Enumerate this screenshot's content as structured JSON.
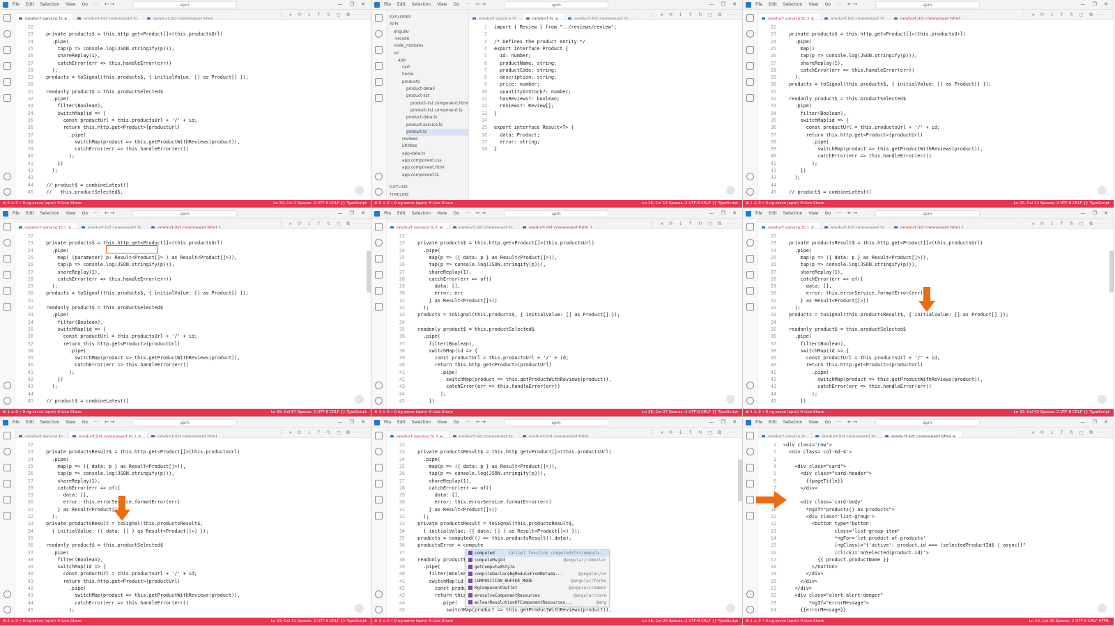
{
  "app": {
    "menu": [
      "File",
      "Edit",
      "Selection",
      "View",
      "Go",
      "···"
    ],
    "search": "apm",
    "window_controls": "— ❐ ✕"
  },
  "panes": [
    {
      "tabs": [
        {
          "label": "product.service.ts",
          "active": true
        },
        {
          "label": "product-list.component.ts",
          "active": false
        },
        {
          "label": "product-list.component.html",
          "active": false
        }
      ],
      "first_line": 22,
      "lines": [
        "",
        "  private products$ = this.http.get<Product[]>(this.productsUrl)",
        "    .pipe(",
        "      tap(p => console.log(JSON.stringify(p))),",
        "      shareReplay(1),",
        "      catchError(err => this.handleError(err))",
        "    );",
        "  products = toSignal(this.products$, { initialValue: [] as Product[] });",
        "",
        "  readonly product$ = this.productSelected$",
        "    .pipe(",
        "      filter(Boolean),",
        "      switchMap(id => {",
        "        const productUrl = this.productsUrl + '/' + id;",
        "        return this.http.get<Product>(productUrl)",
        "          .pipe(",
        "            switchMap(product => this.getProductWithReviews(product)),",
        "            catchError(err => this.handleError(err))",
        "          );",
        "      })",
        "    );",
        "",
        "  // product$ = combineLatest([",
        "  //   this.productSelected$,"
      ],
      "status_left": "⊗ 0 ⚠ 0   ⑂ 0   ng serve (apm)   ⟲ Live Share",
      "status_right": "Ln 30, Col 1   Spaces: 2   UTF-8   CRLF   {} TypeScript"
    },
    {
      "tabs": [
        {
          "label": "product.service.ts",
          "active": false
        },
        {
          "label": "product.ts",
          "active": true
        },
        {
          "label": "product-list.component.ts",
          "active": false
        }
      ],
      "explorer": [
        {
          "label": "EXPLORER",
          "depth": 0,
          "head": true
        },
        {
          "label": "APM",
          "depth": 0,
          "head": true
        },
        {
          "label": "angular",
          "depth": 1
        },
        {
          "label": ".vscode",
          "depth": 1
        },
        {
          "label": "node_modules",
          "depth": 1
        },
        {
          "label": "src",
          "depth": 1
        },
        {
          "label": "app",
          "depth": 2
        },
        {
          "label": "cart",
          "depth": 3
        },
        {
          "label": "home",
          "depth": 3
        },
        {
          "label": "products",
          "depth": 3
        },
        {
          "label": "product-detail",
          "depth": 4
        },
        {
          "label": "product-list",
          "depth": 4
        },
        {
          "label": "product-list.component.html",
          "depth": 5
        },
        {
          "label": "product-list.component.ts",
          "depth": 5
        },
        {
          "label": "product-data.ts",
          "depth": 4
        },
        {
          "label": "product.service.ts",
          "depth": 4
        },
        {
          "label": "product.ts",
          "depth": 4,
          "selected": true
        },
        {
          "label": "reviews",
          "depth": 3
        },
        {
          "label": "utilities",
          "depth": 3
        },
        {
          "label": "app-data.ts",
          "depth": 3
        },
        {
          "label": "app.component.css",
          "depth": 3
        },
        {
          "label": "app.component.html",
          "depth": 3
        },
        {
          "label": "app.component.ts",
          "depth": 3
        },
        {
          "label": "OUTLINE",
          "depth": 0,
          "head": true
        },
        {
          "label": "TIMELINE",
          "depth": 0,
          "head": true
        }
      ],
      "first_line": 1,
      "lines": [
        "import { Review } from \"../reviews/review\";",
        "",
        "/* Defines the product entity */",
        "export interface Product {",
        "  id: number;",
        "  productName: string;",
        "  productCode: string;",
        "  description: string;",
        "  price: number;",
        "  quantityInStock?: number;",
        "  hasReviews?: boolean;",
        "  reviews?: Review[];",
        "}",
        "",
        "export interface Result<T> {",
        "  data: Product;",
        "  error: string;",
        "}"
      ],
      "status_left": "⊗ 0 ⚠ 0   ⑂ 0   ng serve (apm)   ⟲ Live Share",
      "status_right": "Ln 16, Col 13   Spaces: 2   UTF-8   CRLF   {} TypeScript"
    },
    {
      "tabs": [
        {
          "label": "product.service.ts 2",
          "active": true,
          "modified": true
        },
        {
          "label": "product-list.component.ts",
          "active": false
        },
        {
          "label": "product-list.component.html",
          "active": false,
          "modified": true
        }
      ],
      "first_line": 22,
      "lines": [
        "",
        "  private products$ = this.http.get<Product[]>(this.productsUrl)",
        "    .pipe(",
        "      map()",
        "      tap(p => console.log(JSON.stringify(p))),",
        "      shareReplay(1),",
        "      catchError(err => this.handleError(err))",
        "    );",
        "  products = toSignal(this.products$, { initialValue: [] as Product[] });",
        "",
        "  readonly product$ = this.productSelected$",
        "    .pipe(",
        "      filter(Boolean),",
        "      switchMap(id => {",
        "        const productUrl = this.productsUrl + '/' + id;",
        "        return this.http.get<Product>(productUrl)",
        "          .pipe(",
        "            switchMap(product => this.getProductWithReviews(product)),",
        "            catchError(err => this.handleError(err))",
        "          );",
        "      })",
        "    );",
        "",
        "  // product$ = combineLatest(["
      ],
      "status_left": "⊗ 1 ⚠ 0   ⑂ 0   ng serve (apm)   ⟲ Live Share",
      "status_right": "Ln 25, Col 12   Spaces: 2   UTF-8   CRLF   {} TypeScript"
    },
    {
      "tabs": [
        {
          "label": "product.service.ts 1",
          "active": true,
          "modified": true
        },
        {
          "label": "product-list.component.ts",
          "active": false
        },
        {
          "label": "product-list.component.html 1",
          "active": false,
          "modified": true
        }
      ],
      "first_line": 22,
      "lines": [
        "",
        "  private products$ = this.http.get<Product[]>(this.productsUrl)",
        "    .pipe(",
        "      map( (parameter) p: Result<Product[]> ) as Result<Product[]>)),",
        "      tap(p => console.log(JSON.stringify(p))),",
        "      shareReplay(1),",
        "      catchError(err => this.handleError(err))",
        "    );",
        "  products = toSignal(this.products$, { initialValue: [] as Product[] });",
        "",
        "  readonly product$ = this.productSelected$",
        "    .pipe(",
        "      filter(Boolean),",
        "      switchMap(id => {",
        "        const productUrl = this.productsUrl + '/' + id;",
        "        return this.http.get<Product>(productUrl)",
        "          .pipe(",
        "            switchMap(product => this.getProductWithReviews(product)),",
        "            catchError(err => this.handleError(err))",
        "          );",
        "      })",
        "    );",
        "",
        "  // product$ = combineLatest(["
      ],
      "status_left": "⊗ 1 ⚠ 0   ⑂ 0   ng serve (apm)   ⟲ Live Share",
      "status_right": "Ln 25, Col 67   Spaces: 2   UTF-8   CRLF   {} TypeScript"
    },
    {
      "tabs": [
        {
          "label": "product.service.ts 1",
          "active": true,
          "modified": true
        },
        {
          "label": "product-list.component.ts",
          "active": false
        },
        {
          "label": "product-list.component.html 1",
          "active": false,
          "modified": true
        }
      ],
      "first_line": 22,
      "lines": [
        "",
        "  private products$ = this.http.get<Product[]>(this.productsUrl)",
        "    .pipe(",
        "      map(p => ({ data: p } as Result<Product[]>)),",
        "      tap(p => console.log(JSON.stringify(p))),",
        "      shareReplay(1),",
        "      catchError(err => of({",
        "        data: [],",
        "        error: err",
        "      } as Result<Product[]>))",
        "    );",
        "  products = toSignal(this.products$, { initialValue: [] as Product[] });",
        "",
        "  readonly product$ = this.productSelected$",
        "    .pipe(",
        "      filter(Boolean),",
        "      switchMap(id => {",
        "        const productUrl = this.productsUrl + '/' + id;",
        "        return this.http.get<Product>(productUrl)",
        "          .pipe(",
        "            switchMap(product => this.getProductWithReviews(product)),",
        "            catchError(err => this.handleError(err))",
        "          );",
        "      })"
      ],
      "status_left": "⊗ 1 ⚠ 0   ⑂ 0   ng serve (apm)   ⟲ Live Share",
      "status_right": "Ln 28, Col 27   Spaces: 2   UTF-8   CRLF   {} TypeScript"
    },
    {
      "tabs": [
        {
          "label": "product.service.ts 1",
          "active": true,
          "modified": true
        },
        {
          "label": "product-list.component.ts",
          "active": false
        },
        {
          "label": "product-list.component.html 1",
          "active": false,
          "modified": true
        }
      ],
      "first_line": 22,
      "lines": [
        "",
        "  private productsResult$ = this.http.get<Product[]>(this.productsUrl)",
        "    .pipe(",
        "      map(p => ({ data: p } as Result<Product[]>)),",
        "      tap(p => console.log(JSON.stringify(p))),",
        "      shareReplay(1),",
        "      catchError(err => of({",
        "        data: [],",
        "        error: this.errorService.formatError(err)",
        "      } as Result<Product[]>))",
        "    );",
        "  products = toSignal(this.productsResult$, { initialValue: [] as Product[] });",
        "",
        "  readonly product$ = this.productSelected$",
        "    .pipe(",
        "      filter(Boolean),",
        "      switchMap(id => {",
        "        const productUrl = this.productsUrl + '/' + id;",
        "        return this.http.get<Product>(productUrl)",
        "          .pipe(",
        "            switchMap(product => this.getProductWithReviews(product)),",
        "            catchError(err => this.handleError(err))",
        "          );",
        "      })"
      ],
      "status_left": "⊗ 1 ⚠ 0   ⑂ 0   ng serve (apm)   ⟲ Live Share",
      "status_right": "Ln 33, Col 42   Spaces: 2   UTF-8   CRLF   {} TypeScript"
    },
    {
      "tabs": [
        {
          "label": "product.service.ts",
          "active": false
        },
        {
          "label": "product-list.component.ts 1",
          "active": true,
          "modified": true
        },
        {
          "label": "product-list.component.html",
          "active": false
        }
      ],
      "first_line": 22,
      "lines": [
        "",
        "  private productsResult$ = this.http.get<Product[]>(this.productsUrl)",
        "    .pipe(",
        "      map(p => ({ data: p } as Result<Product[]>)),",
        "      tap(p => console.log(JSON.stringify(p))),",
        "      shareReplay(1),",
        "      catchError(err => of({",
        "        data: [],",
        "        error: this.errorService.formatError(err)",
        "      } as Result<Product[]>",
        "    );",
        "  private productsResult = toSignal(this.productsResult$,",
        "    { initialValue: ({ data: [] } as Result<Product[]>) });",
        "",
        "  readonly product$ = this.productSelected$",
        "    .pipe(",
        "      filter(Boolean),",
        "      switchMap(id => {",
        "        const productUrl = this.productsUrl + '/' + id;",
        "        return this.http.get<Product>(productUrl)",
        "          .pipe(",
        "            switchMap(product => this.getProductWithReviews(product)),",
        "            catchError(err => this.handleError(err))",
        "          );"
      ],
      "status_left": "⊗ 2 ⚠ 0   ⑂ 0   ng serve (apm)   ⟲ Live Share",
      "status_right": "Ln 33, Col 11   Spaces: 2   UTF-8   CRLF   {} TypeScript"
    },
    {
      "tabs": [
        {
          "label": "product.service.ts 2",
          "active": true,
          "modified": true
        },
        {
          "label": "product-list.component.ts",
          "active": false
        },
        {
          "label": "product-list.component.html",
          "active": false
        }
      ],
      "first_line": 22,
      "lines": [
        "",
        "  private productsResult$ = this.http.get<Product[]>(this.productsUrl)",
        "    .pipe(",
        "      map(p => ({ data: p } as Result<Product[]>)),",
        "      tap(p => console.log(JSON.stringify(p))),",
        "      shareReplay(1),",
        "      catchError(err => of({",
        "        data: [],",
        "        error: this.errorService.formatError(err)",
        "      } as Result<Product[]>))",
        "    );",
        "  private productsResult = toSignal(this.productsResult$,",
        "    { initialValue: ({ data: [] } as Result<Product[]>) });",
        "  products = computed(() => this.productsResult().data);",
        "  productsError = compute",
        "",
        "  readonly product$ = thi",
        "    .pipe(",
        "      filter(Boolean),",
        "      switchMap(id => {",
        "        const productUrl",
        "        return this.http.",
        "          .pipe(",
        "            switchMap(product => this.getProductWithReviews(product)),"
      ],
      "autocomplete": [
        {
          "label": "computed",
          "detail": "(alias) function computed<T>(computa...",
          "selected": true
        },
        {
          "label": "computeMsgId",
          "detail": "@angular/compiler"
        },
        {
          "label": "getComputedStyle",
          "detail": ""
        },
        {
          "label": "compileDeclareNgModuleFromMetada...",
          "detail": "@angular/co"
        },
        {
          "label": "COMPOSITION_BUFFER_MODE",
          "detail": "@angular/forms"
        },
        {
          "label": "NgComponentOutlet",
          "detail": "@angular/common"
        },
        {
          "label": "ɵresolveComponentResources",
          "detail": "@angular/core"
        },
        {
          "label": "ɵclearResolutionOfComponentResources...",
          "detail": "@ang"
        }
      ],
      "status_left": "⊗ 3 ⚠ 0   ⑂ 0   ng serve (apm)   ⟲ Live Share",
      "status_right": "Ln 36, Col 26   Spaces: 2   UTF-8   CRLF   {} TypeScript"
    },
    {
      "tabs": [
        {
          "label": "product.service.ts",
          "active": false
        },
        {
          "label": "product-list.component.ts",
          "active": false
        },
        {
          "label": "product-list.component.html",
          "active": true
        }
      ],
      "first_line": 1,
      "lines": [
        "<div class='row'>",
        "  <div class='col-md-4'>",
        "",
        "    <div class=\"card\">",
        "      <div class=\"card-header\">",
        "        {{pageTitle}}",
        "      </div>",
        "",
        "      <div class='card-body'",
        "        *ngIf=\"products() as products\">",
        "        <div class='list-group'>",
        "          <button type='button'",
        "                  class='list-group-item'",
        "                  *ngFor='let product of products'",
        "                  [ngClass]=\"{'active': product.id === (selectedProductId$ | async)}\"",
        "                  (click)='onSelected(product.id)'>",
        "            {{ product.productName }}",
        "          </button>",
        "        </div>",
        "      </div>",
        "    </div>",
        "    <div class=\"alert alert-danger\"",
        "         *ngIf=\"errorMessage\">",
        "      {{errorMessage}}"
      ],
      "status_left": "⊗ 1 ⚠ 0   ⑂ 0   ng serve (apm)   ⟲ Live Share",
      "status_right": "Ln 10, Col 26   Spaces: 2   UTF-8   CRLF   HTML"
    }
  ]
}
